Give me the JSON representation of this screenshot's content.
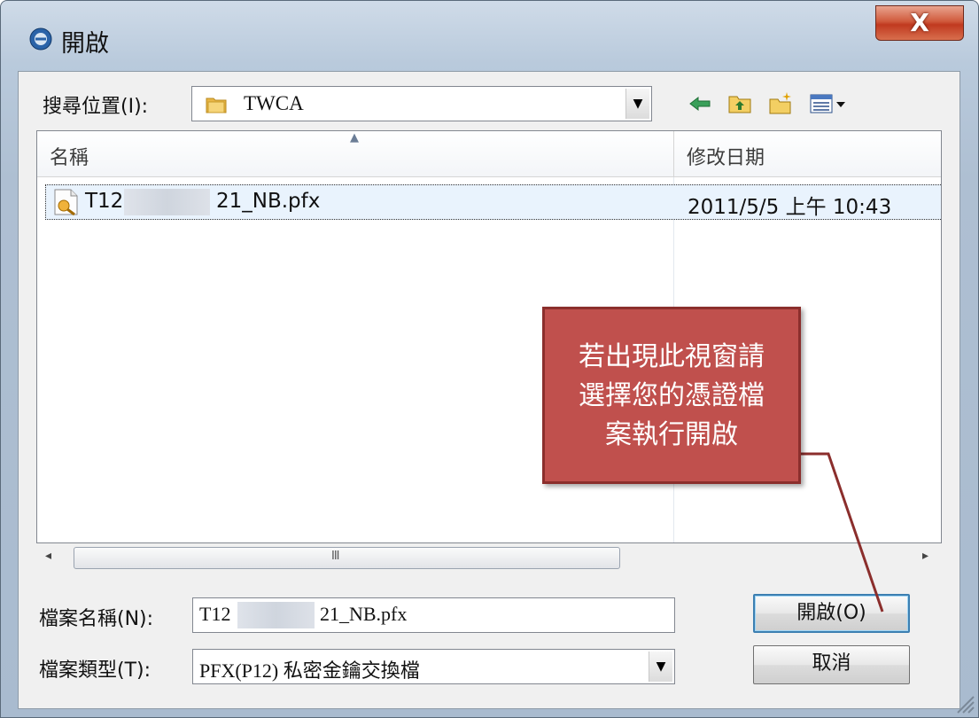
{
  "window": {
    "title": "開啟",
    "close_label": "X"
  },
  "lookin": {
    "label": "搜尋位置(I):",
    "value": "TWCA"
  },
  "toolbar_icons": [
    "back-arrow-icon",
    "up-folder-icon",
    "new-folder-icon",
    "view-menu-icon"
  ],
  "list": {
    "columns": [
      "名稱",
      "修改日期"
    ],
    "rows": [
      {
        "name_start": "T12",
        "name_end": "21_NB.pfx",
        "modified": "2011/5/5 上午 10:43"
      }
    ]
  },
  "scrollbar": {
    "left_arrow": "◂",
    "right_arrow": "▸",
    "grip": "III"
  },
  "filename": {
    "label": "檔案名稱(N):",
    "value_start": "T12",
    "value_end": "21_NB.pfx"
  },
  "filetype": {
    "label": "檔案類型(T):",
    "value": "PFX(P12) 私密金鑰交換檔"
  },
  "buttons": {
    "open": "開啟(O)",
    "cancel": "取消"
  },
  "callout": {
    "lines": [
      "若出現此視窗請",
      "選擇您的憑證檔",
      "案執行開啟"
    ],
    "color": "#c0504d"
  }
}
